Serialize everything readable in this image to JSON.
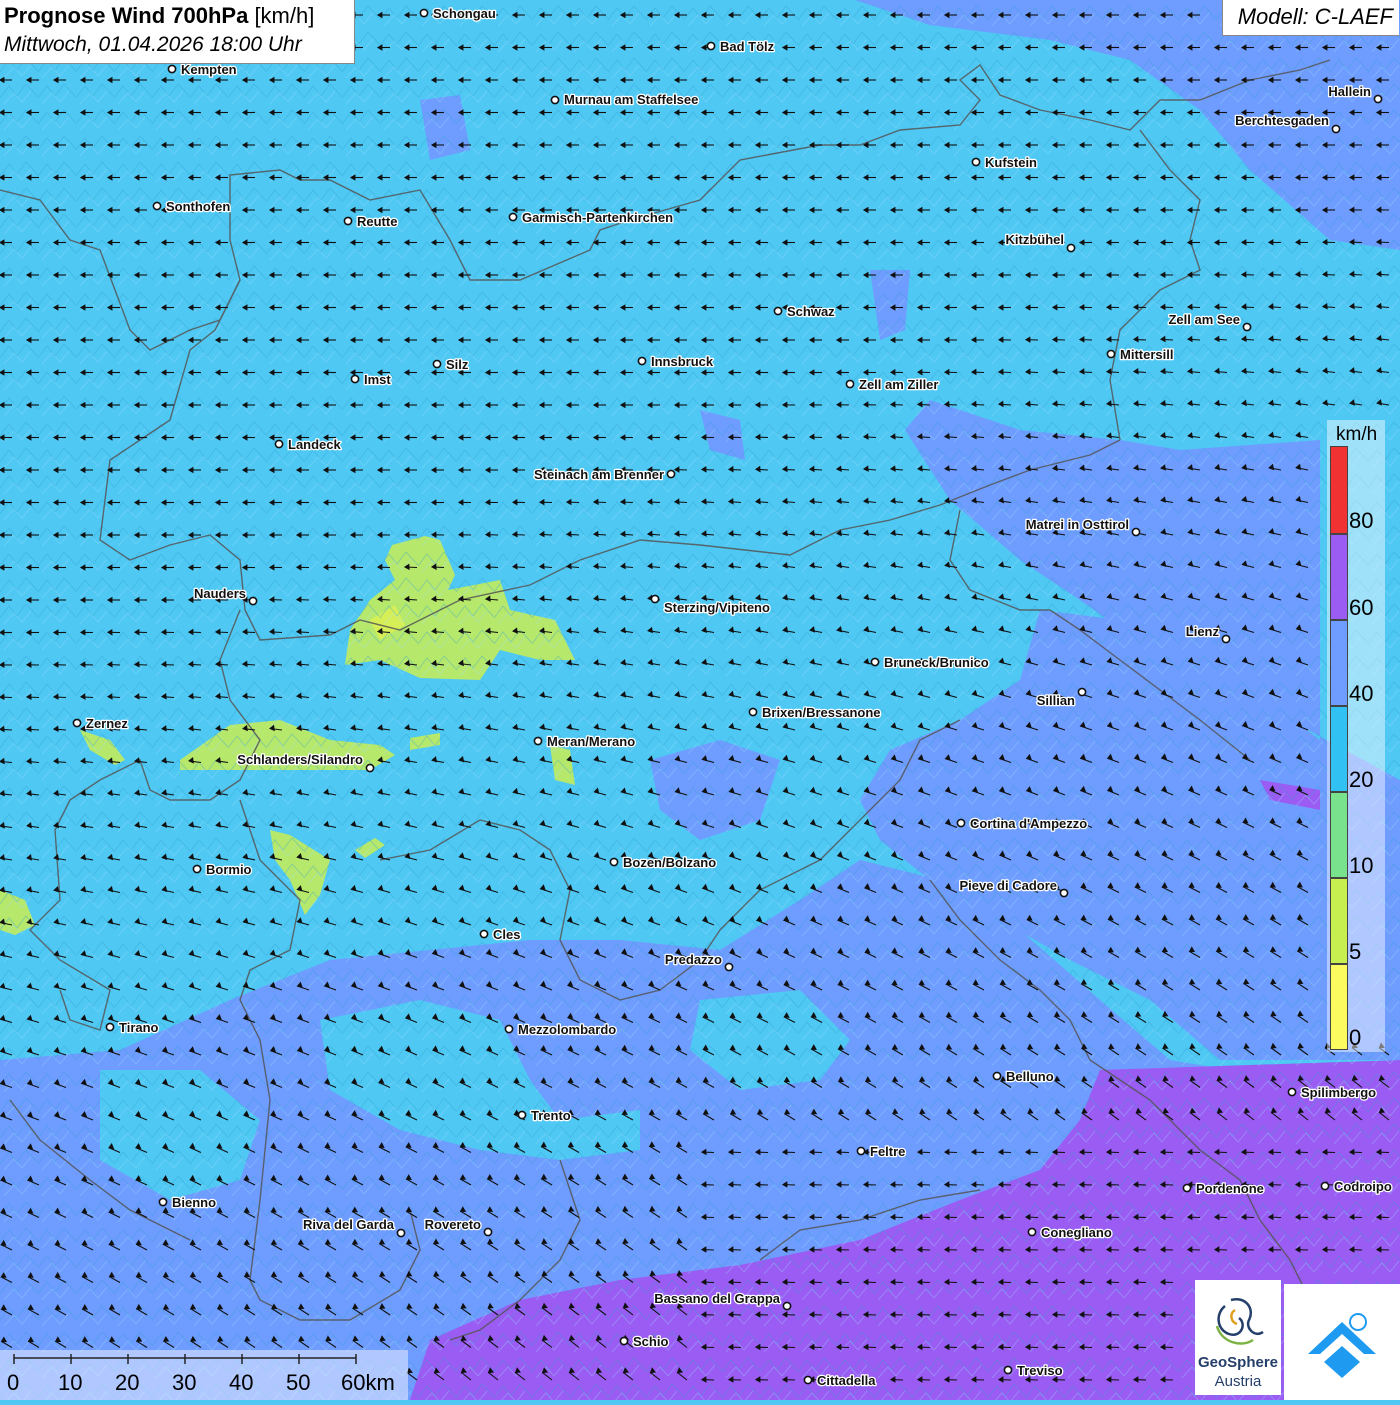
{
  "title": {
    "bold": "Prognose Wind 700hPa",
    "unit": "[km/h]",
    "datetime": "Mittwoch, 01.04.2026 18:00 Uhr"
  },
  "model": "Modell: C-LAEF",
  "legend": {
    "unit": "km/h",
    "labels": [
      "80",
      "60",
      "40",
      "20",
      "10",
      "5",
      "0"
    ],
    "colors": [
      "#f03232",
      "#9a5cf3",
      "#6f9cff",
      "#31c1f3",
      "#78e38c",
      "#c7ef50",
      "#fbfb60"
    ]
  },
  "scale": {
    "labels": [
      "0",
      "10",
      "20",
      "30",
      "40",
      "50",
      "60km"
    ]
  },
  "logo": {
    "line1": "GeoSphere",
    "line2": "Austria"
  },
  "colors": {
    "background": "#4fc8f3",
    "blue_zone": "#6f9cff",
    "purple_zone": "#9a5cf3",
    "green_zone": "#b6e86c",
    "arrow": "#111111",
    "border": "#555555"
  },
  "cities": [
    {
      "name": "Schongau",
      "dot": [
        424,
        13
      ],
      "lab": [
        433,
        18
      ],
      "anchor": "start"
    },
    {
      "name": "Bad Tölz",
      "dot": [
        711,
        46
      ],
      "lab": [
        720,
        51
      ],
      "anchor": "start"
    },
    {
      "name": "Kempten",
      "dot": [
        172,
        69
      ],
      "lab": [
        181,
        74
      ],
      "anchor": "start"
    },
    {
      "name": "Murnau am Staffelsee",
      "dot": [
        555,
        100
      ],
      "lab": [
        564,
        104
      ],
      "anchor": "start"
    },
    {
      "name": "Hallein",
      "dot": [
        1378,
        99
      ],
      "lab": [
        1371,
        96
      ],
      "anchor": "end"
    },
    {
      "name": "Berchtesgaden",
      "dot": [
        1336,
        129
      ],
      "lab": [
        1329,
        125
      ],
      "anchor": "end"
    },
    {
      "name": "Kufstein",
      "dot": [
        976,
        162
      ],
      "lab": [
        985,
        167
      ],
      "anchor": "start"
    },
    {
      "name": "Sonthofen",
      "dot": [
        157,
        206
      ],
      "lab": [
        166,
        211
      ],
      "anchor": "start"
    },
    {
      "name": "Reutte",
      "dot": [
        348,
        221
      ],
      "lab": [
        357,
        226
      ],
      "anchor": "start"
    },
    {
      "name": "Garmisch-Partenkirchen",
      "dot": [
        513,
        217
      ],
      "lab": [
        522,
        222
      ],
      "anchor": "start"
    },
    {
      "name": "Kitzbühel",
      "dot": [
        1071,
        248
      ],
      "lab": [
        1064,
        244
      ],
      "anchor": "end"
    },
    {
      "name": "Schwaz",
      "dot": [
        778,
        311
      ],
      "lab": [
        787,
        316
      ],
      "anchor": "start"
    },
    {
      "name": "Zell am See",
      "dot": [
        1247,
        327
      ],
      "lab": [
        1240,
        324
      ],
      "anchor": "end"
    },
    {
      "name": "Mittersill",
      "dot": [
        1111,
        354
      ],
      "lab": [
        1120,
        359
      ],
      "anchor": "start"
    },
    {
      "name": "Innsbruck",
      "dot": [
        642,
        361
      ],
      "lab": [
        651,
        366
      ],
      "anchor": "start"
    },
    {
      "name": "Silz",
      "dot": [
        437,
        364
      ],
      "lab": [
        446,
        369
      ],
      "anchor": "start"
    },
    {
      "name": "Imst",
      "dot": [
        355,
        379
      ],
      "lab": [
        364,
        384
      ],
      "anchor": "start"
    },
    {
      "name": "Zell am Ziller",
      "dot": [
        850,
        384
      ],
      "lab": [
        859,
        389
      ],
      "anchor": "start"
    },
    {
      "name": "Landeck",
      "dot": [
        279,
        444
      ],
      "lab": [
        288,
        449
      ],
      "anchor": "start"
    },
    {
      "name": "Steinach am Brenner",
      "dot": [
        671,
        474
      ],
      "lab": [
        664,
        479
      ],
      "anchor": "end"
    },
    {
      "name": "Matrei in Osttirol",
      "dot": [
        1136,
        532
      ],
      "lab": [
        1129,
        529
      ],
      "anchor": "end"
    },
    {
      "name": "Nauders",
      "dot": [
        253,
        601
      ],
      "lab": [
        246,
        598
      ],
      "anchor": "end"
    },
    {
      "name": "Sterzing/Vipiteno",
      "dot": [
        655,
        599
      ],
      "lab": [
        664,
        612
      ],
      "anchor": "start"
    },
    {
      "name": "Lienz",
      "dot": [
        1226,
        639
      ],
      "lab": [
        1219,
        636
      ],
      "anchor": "end"
    },
    {
      "name": "Bruneck/Brunico",
      "dot": [
        875,
        662
      ],
      "lab": [
        884,
        667
      ],
      "anchor": "start"
    },
    {
      "name": "Sillian",
      "dot": [
        1082,
        692
      ],
      "lab": [
        1075,
        705
      ],
      "anchor": "end"
    },
    {
      "name": "Brixen/Bressanone",
      "dot": [
        753,
        712
      ],
      "lab": [
        762,
        717
      ],
      "anchor": "start"
    },
    {
      "name": "Zernez",
      "dot": [
        77,
        723
      ],
      "lab": [
        86,
        728
      ],
      "anchor": "start"
    },
    {
      "name": "Meran/Merano",
      "dot": [
        538,
        741
      ],
      "lab": [
        547,
        746
      ],
      "anchor": "start"
    },
    {
      "name": "Schlanders/Silandro",
      "dot": [
        370,
        768
      ],
      "lab": [
        363,
        764
      ],
      "anchor": "end"
    },
    {
      "name": "Cortina d'Ampezzo",
      "dot": [
        961,
        823
      ],
      "lab": [
        970,
        828
      ],
      "anchor": "start"
    },
    {
      "name": "Bozen/Bolzano",
      "dot": [
        614,
        862
      ],
      "lab": [
        623,
        867
      ],
      "anchor": "start"
    },
    {
      "name": "Bormio",
      "dot": [
        197,
        869
      ],
      "lab": [
        206,
        874
      ],
      "anchor": "start"
    },
    {
      "name": "Pieve di Cadore",
      "dot": [
        1064,
        893
      ],
      "lab": [
        1057,
        890
      ],
      "anchor": "end"
    },
    {
      "name": "Cles",
      "dot": [
        484,
        934
      ],
      "lab": [
        493,
        939
      ],
      "anchor": "start"
    },
    {
      "name": "Predazzo",
      "dot": [
        729,
        967
      ],
      "lab": [
        722,
        964
      ],
      "anchor": "end"
    },
    {
      "name": "Tirano",
      "dot": [
        110,
        1027
      ],
      "lab": [
        119,
        1032
      ],
      "anchor": "start"
    },
    {
      "name": "Mezzolombardo",
      "dot": [
        509,
        1029
      ],
      "lab": [
        518,
        1034
      ],
      "anchor": "start"
    },
    {
      "name": "Belluno",
      "dot": [
        997,
        1076
      ],
      "lab": [
        1006,
        1081
      ],
      "anchor": "start"
    },
    {
      "name": "Spilimbergo",
      "dot": [
        1292,
        1092
      ],
      "lab": [
        1301,
        1097
      ],
      "anchor": "start"
    },
    {
      "name": "Trento",
      "dot": [
        522,
        1115
      ],
      "lab": [
        531,
        1120
      ],
      "anchor": "start"
    },
    {
      "name": "Feltre",
      "dot": [
        861,
        1151
      ],
      "lab": [
        870,
        1156
      ],
      "anchor": "start"
    },
    {
      "name": "Pordenone",
      "dot": [
        1187,
        1188
      ],
      "lab": [
        1196,
        1193
      ],
      "anchor": "start"
    },
    {
      "name": "Codroipo",
      "dot": [
        1325,
        1186
      ],
      "lab": [
        1334,
        1191
      ],
      "anchor": "start"
    },
    {
      "name": "Bienno",
      "dot": [
        163,
        1202
      ],
      "lab": [
        172,
        1207
      ],
      "anchor": "start"
    },
    {
      "name": "Riva del Garda",
      "dot": [
        401,
        1233
      ],
      "lab": [
        394,
        1229
      ],
      "anchor": "end"
    },
    {
      "name": "Rovereto",
      "dot": [
        488,
        1232
      ],
      "lab": [
        481,
        1229
      ],
      "anchor": "end"
    },
    {
      "name": "Conegliano",
      "dot": [
        1032,
        1232
      ],
      "lab": [
        1041,
        1237
      ],
      "anchor": "start"
    },
    {
      "name": "Bassano del Grappa",
      "dot": [
        787,
        1306
      ],
      "lab": [
        780,
        1303
      ],
      "anchor": "end"
    },
    {
      "name": "Schio",
      "dot": [
        624,
        1341
      ],
      "lab": [
        633,
        1346
      ],
      "anchor": "start"
    },
    {
      "name": "Treviso",
      "dot": [
        1008,
        1370
      ],
      "lab": [
        1017,
        1375
      ],
      "anchor": "start"
    },
    {
      "name": "Cittadella",
      "dot": [
        808,
        1380
      ],
      "lab": [
        817,
        1385
      ],
      "anchor": "start"
    }
  ]
}
